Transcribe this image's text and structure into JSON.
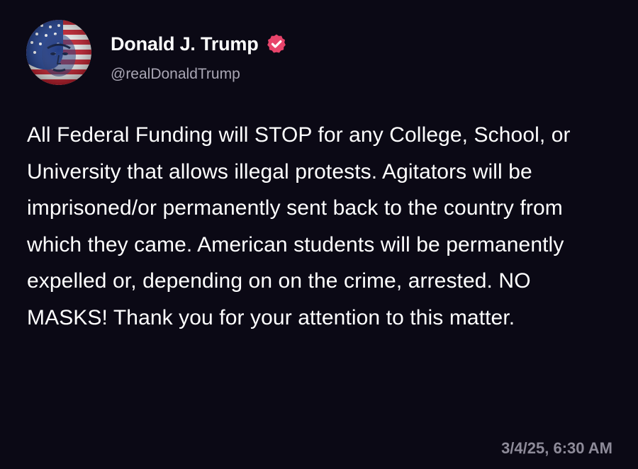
{
  "author": {
    "name": "Donald J. Trump",
    "handle": "@realDonaldTrump",
    "verified": true,
    "avatar_icon": "flag-face-avatar",
    "verified_icon": "verified-badge-icon",
    "verified_color": "#e8446b"
  },
  "post": {
    "text": "All Federal Funding will STOP for any College, School, or University that allows illegal protests. Agitators will be imprisoned/or permanently sent back to the country from which they came. American students will be permanently expelled or, depending on on the crime, arrested. NO MASKS! Thank you for your attention to this matter.",
    "timestamp": "3/4/25, 6:30 AM"
  },
  "colors": {
    "background": "#0b0915",
    "text": "#ffffff",
    "handle": "#a9a6b4",
    "timestamp": "#8e8b99"
  }
}
